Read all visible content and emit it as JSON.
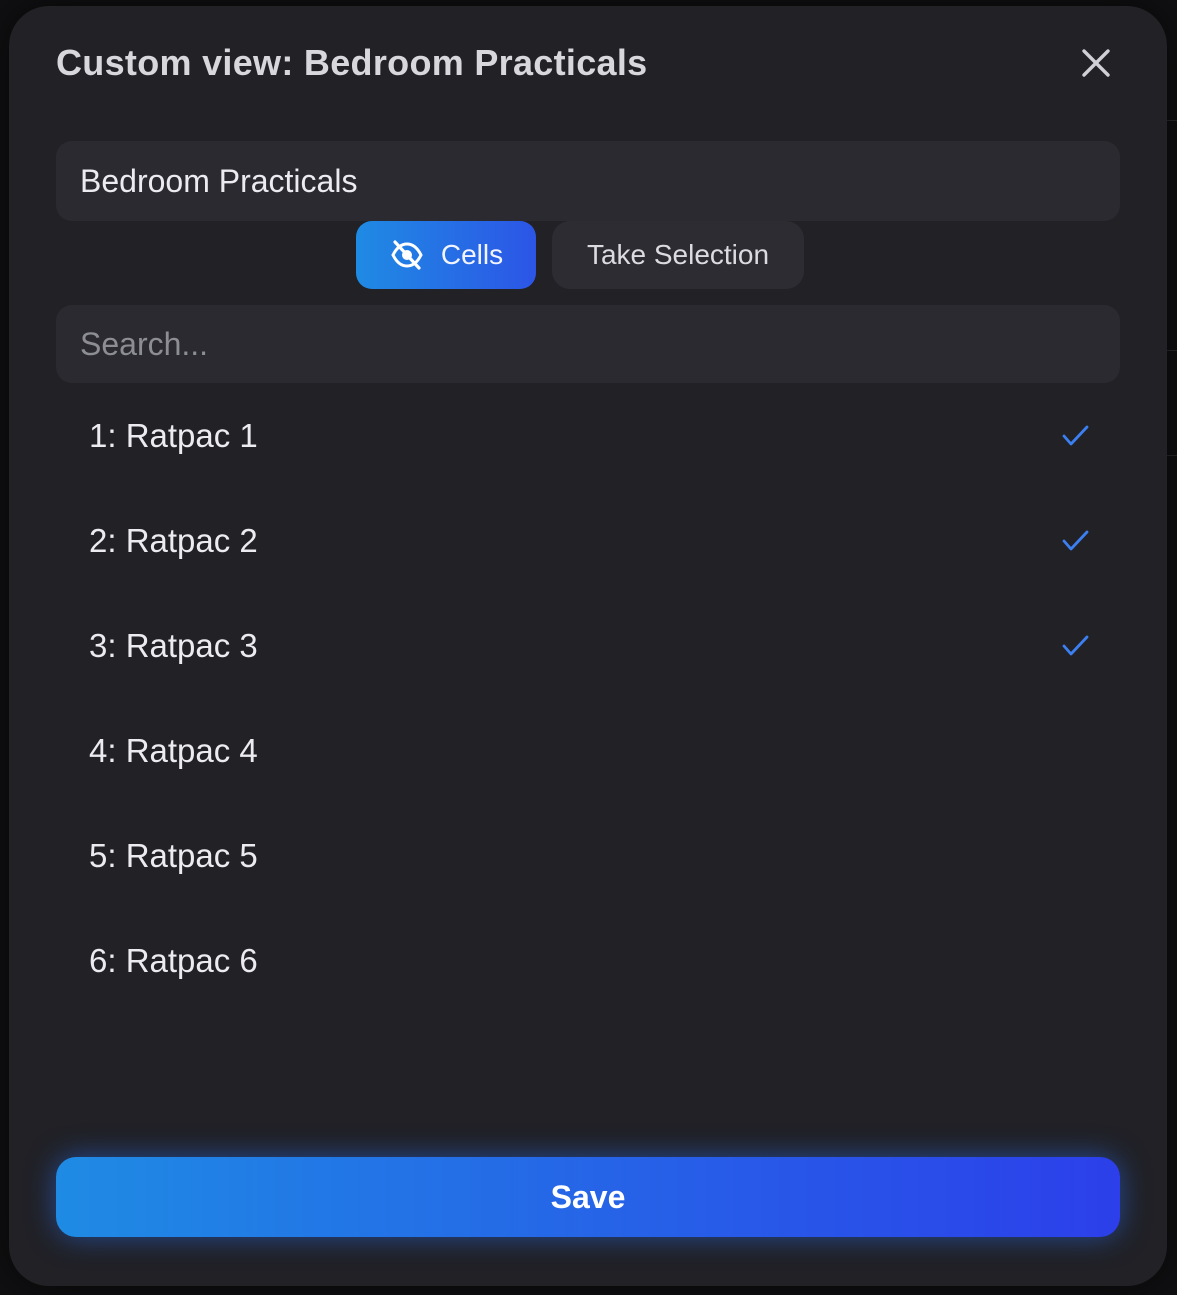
{
  "dialog": {
    "title": "Custom view: Bedroom Practicals",
    "name_value": "Bedroom Practicals",
    "close_icon": "close-icon"
  },
  "toolbar": {
    "cells_label": "Cells",
    "cells_icon": "eye-off-icon",
    "take_selection_label": "Take Selection"
  },
  "search": {
    "placeholder": "Search..."
  },
  "items": [
    {
      "label": "1: Ratpac 1",
      "checked": true
    },
    {
      "label": "2: Ratpac 2",
      "checked": true
    },
    {
      "label": "3: Ratpac 3",
      "checked": true
    },
    {
      "label": "4: Ratpac 4",
      "checked": false
    },
    {
      "label": "5: Ratpac 5",
      "checked": false
    },
    {
      "label": "6: Ratpac 6",
      "checked": false
    }
  ],
  "save_label": "Save",
  "colors": {
    "accent_start": "#1f8be4",
    "accent_end": "#2c3fea",
    "check": "#3b7ff0",
    "panel": "#212126"
  }
}
